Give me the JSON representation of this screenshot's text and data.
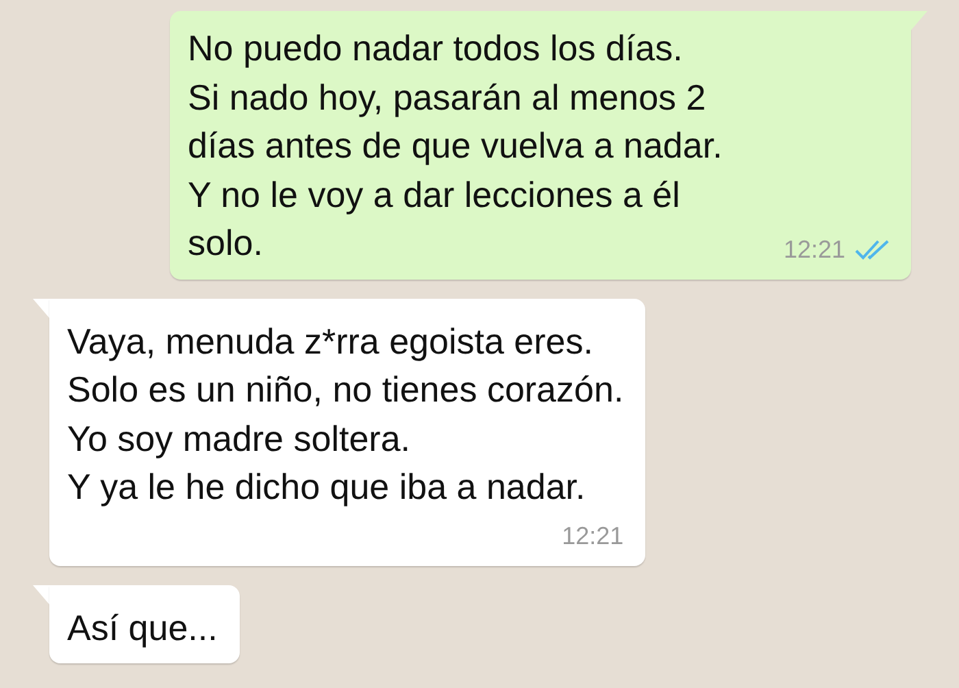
{
  "messages": [
    {
      "kind": "outgoing",
      "lines": [
        "No puedo nadar todos los días.",
        "Si nado hoy, pasarán al menos 2",
        "días antes de que vuelva a nadar.",
        "Y no le voy a dar lecciones a él",
        "solo."
      ],
      "time": "12:21",
      "read": true
    },
    {
      "kind": "incoming",
      "lines": [
        "Vaya, menuda z*rra egoista eres.",
        "Solo es un niño, no tienes corazón.",
        "Yo soy madre soltera.",
        "Y ya le he dicho que iba a nadar."
      ],
      "time": "12:21"
    },
    {
      "kind": "incoming",
      "lines": [
        "Así que..."
      ]
    }
  ]
}
